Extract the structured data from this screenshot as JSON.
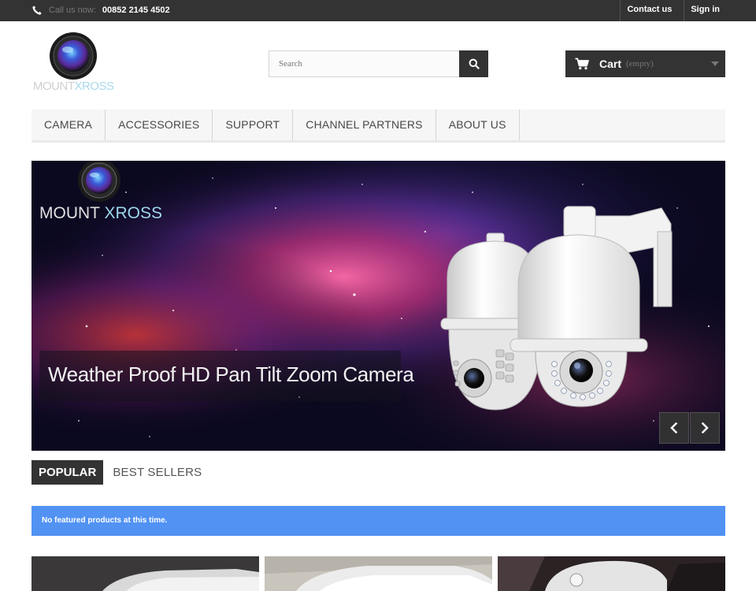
{
  "topbar": {
    "call_prefix": "Call us now:",
    "phone": "00852 2145 4502",
    "contact_label": "Contact us",
    "signin_label": "Sign in"
  },
  "logo": {
    "brand_main": "MOUNT",
    "brand_accent": "XROSS"
  },
  "search": {
    "placeholder": "Search"
  },
  "cart": {
    "label": "Cart",
    "status": "(empty)"
  },
  "menu": {
    "items": [
      "CAMERA",
      "ACCESSORIES",
      "SUPPORT",
      "CHANNEL PARTNERS",
      "ABOUT US"
    ]
  },
  "banner": {
    "brand_main": "MOUNT ",
    "brand_accent": "XROSS",
    "caption": "Weather Proof HD Pan Tilt Zoom Camera"
  },
  "tabs": {
    "popular": "POPULAR",
    "best_sellers": "BEST SELLERS"
  },
  "alert": {
    "message": "No featured products at this time."
  },
  "colors": {
    "dark": "#333333",
    "alert_blue": "#5192f3",
    "menu_bg": "#f6f6f6"
  },
  "icons": [
    "phone-icon",
    "search-icon",
    "cart-icon",
    "chevron-left-icon",
    "chevron-right-icon"
  ]
}
